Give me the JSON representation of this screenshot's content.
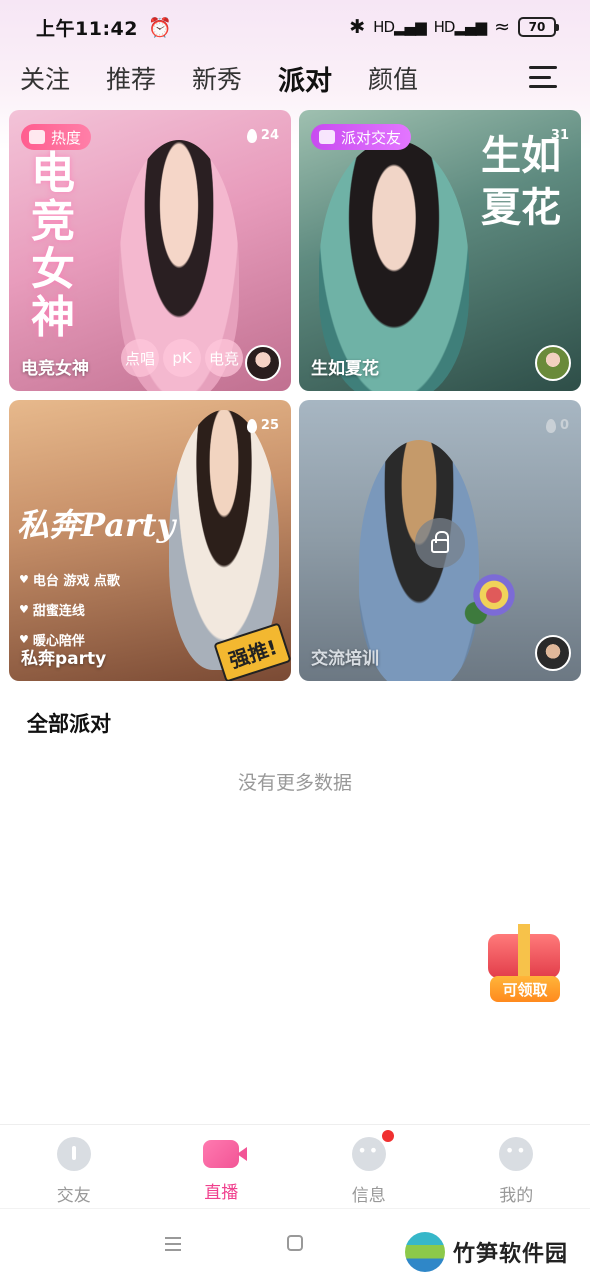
{
  "status_bar": {
    "time": "上午11:42",
    "battery": "70",
    "signal_1": "HD",
    "signal_2": "HD"
  },
  "top_tabs": [
    {
      "label": "关注",
      "active": false
    },
    {
      "label": "推荐",
      "active": false
    },
    {
      "label": "新秀",
      "active": false
    },
    {
      "label": "派对",
      "active": true
    },
    {
      "label": "颜值",
      "active": false
    }
  ],
  "cards": [
    {
      "tag": "热度",
      "heat": "24",
      "title": "电竞女神",
      "chips": [
        "点唱",
        "pK",
        "电竞"
      ],
      "name": "电竞女神"
    },
    {
      "tag": "派对交友",
      "heat": "31",
      "title": "生如夏花",
      "name": "生如夏花"
    },
    {
      "heat": "25",
      "title": "私奔Party",
      "bullets": [
        "电台 游戏 点歌",
        "甜蜜连线",
        "暖心陪伴"
      ],
      "badge": "强推!",
      "name": "私奔party"
    },
    {
      "heat": "0",
      "name": "交流培训",
      "locked": true
    }
  ],
  "section": {
    "title": "全部派对",
    "empty_text": "没有更多数据"
  },
  "gift": {
    "label": "可领取"
  },
  "bottom_nav": [
    {
      "label": "交友",
      "icon": "friend-icon",
      "active": false
    },
    {
      "label": "直播",
      "icon": "live-camera-icon",
      "active": true
    },
    {
      "label": "信息",
      "icon": "message-icon",
      "active": false,
      "badge": true
    },
    {
      "label": "我的",
      "icon": "profile-icon",
      "active": false
    }
  ],
  "watermark": {
    "text": "竹笋软件园"
  },
  "colors": {
    "accent": "#f0408e",
    "inactive": "#999999"
  }
}
